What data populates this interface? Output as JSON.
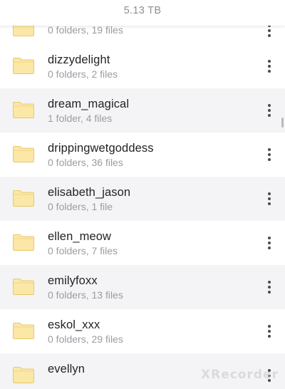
{
  "header": {
    "storage_used": "5.13 TB"
  },
  "folders": [
    {
      "name": "",
      "meta": "0 folders, 19 files"
    },
    {
      "name": "dizzydelight",
      "meta": "0 folders, 2 files"
    },
    {
      "name": "dream_magical",
      "meta": "1 folder, 4 files"
    },
    {
      "name": "drippingwetgoddess",
      "meta": "0 folders, 36 files"
    },
    {
      "name": "elisabeth_jason",
      "meta": "0 folders, 1 file"
    },
    {
      "name": "ellen_meow",
      "meta": "0 folders, 7 files"
    },
    {
      "name": "emilyfoxx",
      "meta": "0 folders, 13 files"
    },
    {
      "name": "eskol_xxx",
      "meta": "0 folders, 29 files"
    },
    {
      "name": "evellyn",
      "meta": ""
    }
  ],
  "icons": {
    "folder": "folder-icon",
    "more": "more-vertical-icon"
  },
  "colors": {
    "folder_fill": "#fbe7a6",
    "folder_stroke": "#e8c86c",
    "alt_row_bg": "#f4f4f6",
    "name_text": "#222326",
    "meta_text": "#9a9ca3"
  },
  "watermark": "XRecorder"
}
